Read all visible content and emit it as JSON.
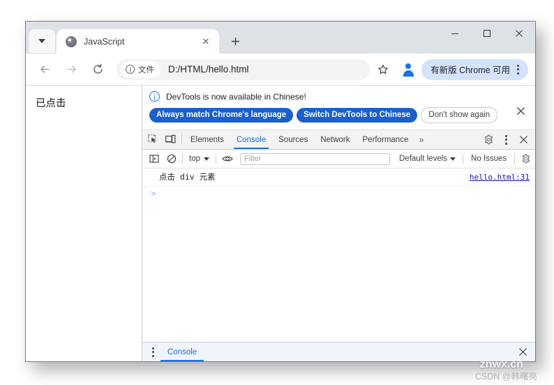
{
  "browser": {
    "tab": {
      "title": "JavaScript",
      "favicon": "globe-icon",
      "close_label": "✕"
    },
    "tab_search_label": "tab-search",
    "new_tab_label": "+",
    "window_controls": {
      "minimize": "minimize-icon",
      "maximize": "maximize-icon",
      "close": "close-icon"
    },
    "toolbar": {
      "back": "←",
      "forward": "→",
      "reload": "⟳",
      "site_chip_label": "文件",
      "url": "D:/HTML/hello.html",
      "bookmark": "star-icon",
      "profile": "profile-avatar-icon",
      "update_pill_label": "有新版 Chrome 可用",
      "menu": "kebab-menu-icon"
    }
  },
  "page": {
    "text": "已点击"
  },
  "devtools": {
    "banner": {
      "message": "DevTools is now available in Chinese!",
      "buttons": [
        {
          "label": "Always match Chrome's language",
          "style": "filled"
        },
        {
          "label": "Switch DevTools to Chinese",
          "style": "filled"
        },
        {
          "label": "Don't show again",
          "style": "outline"
        }
      ],
      "close_label": "✕"
    },
    "tabbar": {
      "inspect_icon": "inspect-element-icon",
      "device_icon": "device-toolbar-icon",
      "tabs": [
        {
          "label": "Elements",
          "active": false
        },
        {
          "label": "Console",
          "active": true
        },
        {
          "label": "Sources",
          "active": false
        },
        {
          "label": "Network",
          "active": false
        },
        {
          "label": "Performance",
          "active": false
        }
      ],
      "more_label": "»",
      "settings_icon": "gear-icon",
      "menu_icon": "kebab-menu-icon",
      "close_label": "✕"
    },
    "console_toolbar": {
      "sidebar_toggle": "console-sidebar-icon",
      "clear_console": "clear-console-icon",
      "context": "top",
      "eye_icon": "live-expression-eye-icon",
      "filter_placeholder": "Filter",
      "filter_value": "",
      "levels": "Default levels",
      "issues": "No Issues",
      "settings_icon": "gear-icon"
    },
    "console_log": [
      {
        "message": "点击 div 元素",
        "source": "hello.html:31"
      }
    ],
    "prompt_caret": ">",
    "drawer": {
      "menu_icon": "kebab-menu-icon",
      "tab_label": "Console",
      "close_label": "✕"
    }
  },
  "watermark": {
    "top": "znwx.cn",
    "bottom": "CSDN @韩曙亮"
  },
  "colors": {
    "accent_blue": "#1a73e8",
    "button_blue": "#1a5fd0",
    "tabstrip_bg": "#dee1e6",
    "omnibox_bg": "#f1f3f4",
    "update_pill_bg": "#d3e3fd",
    "link_blue": "#1a0dab"
  }
}
